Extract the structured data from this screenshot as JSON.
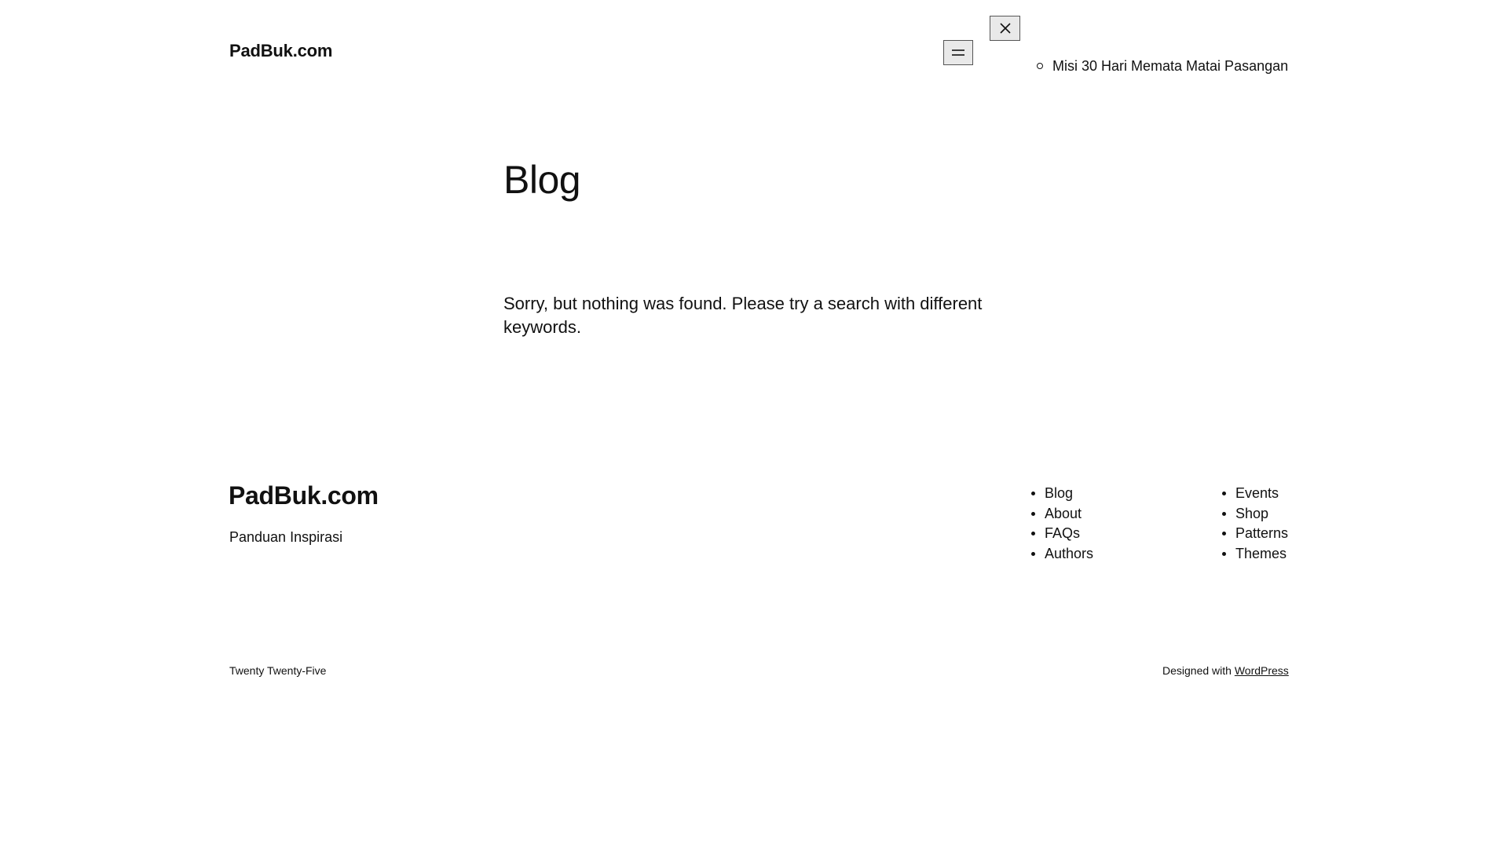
{
  "header": {
    "site_title": "PadBuk.com",
    "menu_items": [
      {
        "label": "Misi 30 Hari Memata Matai Pasangan"
      }
    ],
    "menu_icon": "hamburger-icon",
    "close_icon": "close-icon"
  },
  "main": {
    "heading": "Blog",
    "message": "Sorry, but nothing was found. Please try a search with different keywords."
  },
  "footer": {
    "site_title": "PadBuk.com",
    "tagline": "Panduan Inspirasi",
    "nav_col_1": [
      {
        "label": "Blog"
      },
      {
        "label": "About"
      },
      {
        "label": "FAQs"
      },
      {
        "label": "Authors"
      }
    ],
    "nav_col_2": [
      {
        "label": "Events"
      },
      {
        "label": "Shop"
      },
      {
        "label": "Patterns"
      },
      {
        "label": "Themes"
      }
    ],
    "credit_left": "Twenty Twenty-Five",
    "credit_right_prefix": "Designed with",
    "credit_right_link": "WordPress"
  }
}
